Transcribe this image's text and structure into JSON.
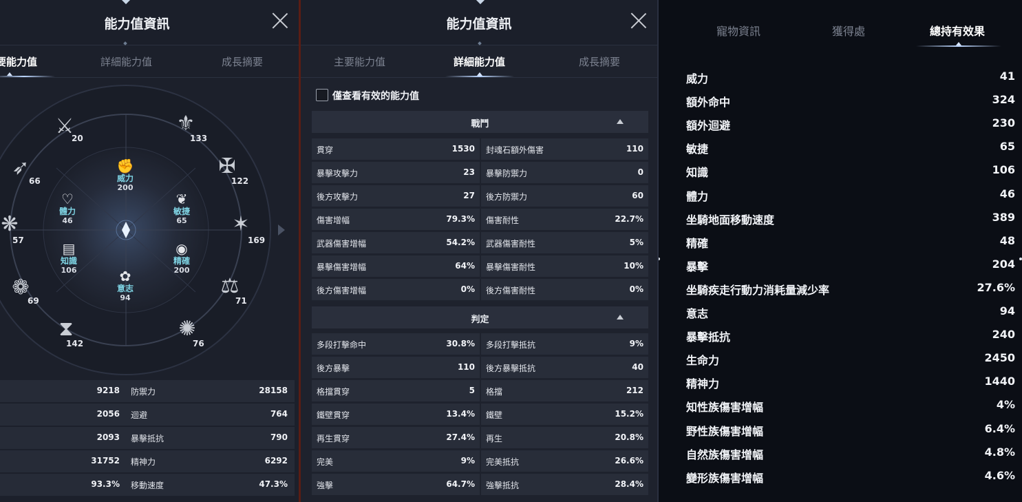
{
  "panel1": {
    "title": "能力值資訊",
    "tabs": [
      "要能力值",
      "詳細能力值",
      "成長摘要"
    ],
    "active_tab": 0,
    "center_stats": [
      {
        "label": "威力",
        "value": "200",
        "icon": "fist-icon"
      },
      {
        "label": "體力",
        "value": "46",
        "icon": "heart-icon"
      },
      {
        "label": "敏捷",
        "value": "65",
        "icon": "wing-icon"
      },
      {
        "label": "知識",
        "value": "106",
        "icon": "book-icon"
      },
      {
        "label": "精確",
        "value": "200",
        "icon": "eye-icon"
      },
      {
        "label": "意志",
        "value": "94",
        "icon": "lotus-icon"
      }
    ],
    "ring_values": [
      "20",
      "133",
      "66",
      "122",
      "57",
      "169",
      "69",
      "71",
      "142",
      "76"
    ],
    "stats": [
      {
        "left_value": "9218",
        "right_name": "防禦力",
        "right_value": "28158"
      },
      {
        "left_value": "2056",
        "right_name": "迴避",
        "right_value": "764"
      },
      {
        "left_value": "2093",
        "right_name": "暴擊抵抗",
        "right_value": "790"
      },
      {
        "left_value": "31752",
        "right_name": "精神力",
        "right_value": "6292"
      },
      {
        "left_value": "93.3%",
        "right_name": "移動速度",
        "right_value": "47.3%"
      }
    ]
  },
  "panel2": {
    "title": "能力值資訊",
    "tabs": [
      "主要能力值",
      "詳細能力值",
      "成長摘要"
    ],
    "active_tab": 1,
    "checkbox_label": "僅查看有效的能力值",
    "sections": [
      {
        "title": "戰鬥",
        "rows": [
          {
            "ln": "貫穿",
            "lv": "1530",
            "rn": "封魂石額外傷害",
            "rv": "110"
          },
          {
            "ln": "暴擊攻擊力",
            "lv": "23",
            "rn": "暴擊防禦力",
            "rv": "0"
          },
          {
            "ln": "後方攻擊力",
            "lv": "27",
            "rn": "後方防禦力",
            "rv": "60"
          },
          {
            "ln": "傷害增幅",
            "lv": "79.3%",
            "rn": "傷害耐性",
            "rv": "22.7%"
          },
          {
            "ln": "武器傷害增幅",
            "lv": "54.2%",
            "rn": "武器傷害耐性",
            "rv": "5%"
          },
          {
            "ln": "暴擊傷害增幅",
            "lv": "64%",
            "rn": "暴擊傷害耐性",
            "rv": "10%"
          },
          {
            "ln": "後方傷害增幅",
            "lv": "0%",
            "rn": "後方傷害耐性",
            "rv": "0%"
          }
        ]
      },
      {
        "title": "判定",
        "rows": [
          {
            "ln": "多段打擊命中",
            "lv": "30.8%",
            "rn": "多段打擊抵抗",
            "rv": "9%"
          },
          {
            "ln": "後方暴擊",
            "lv": "110",
            "rn": "後方暴擊抵抗",
            "rv": "40"
          },
          {
            "ln": "格擋貫穿",
            "lv": "5",
            "rn": "格擋",
            "rv": "212"
          },
          {
            "ln": "鐵壁貫穿",
            "lv": "13.4%",
            "rn": "鐵壁",
            "rv": "15.2%"
          },
          {
            "ln": "再生貫穿",
            "lv": "27.4%",
            "rn": "再生",
            "rv": "20.8%"
          },
          {
            "ln": "完美",
            "lv": "9%",
            "rn": "完美抵抗",
            "rv": "26.6%"
          },
          {
            "ln": "強擊",
            "lv": "64.7%",
            "rn": "強擊抵抗",
            "rv": "28.4%"
          }
        ]
      }
    ]
  },
  "panel3": {
    "tabs": [
      "寵物資訊",
      "獲得處",
      "總持有效果"
    ],
    "active_tab": 2,
    "effects": [
      {
        "name": "威力",
        "value": "41"
      },
      {
        "name": "額外命中",
        "value": "324"
      },
      {
        "name": "額外迴避",
        "value": "230"
      },
      {
        "name": "敏捷",
        "value": "65"
      },
      {
        "name": "知識",
        "value": "106"
      },
      {
        "name": "體力",
        "value": "46"
      },
      {
        "name": "坐騎地面移動速度",
        "value": "389"
      },
      {
        "name": "精確",
        "value": "48"
      },
      {
        "name": "暴擊",
        "value": "204"
      },
      {
        "name": "坐騎疾走行動力消耗量減少率",
        "value": "27.6%"
      },
      {
        "name": "意志",
        "value": "94"
      },
      {
        "name": "暴擊抵抗",
        "value": "240"
      },
      {
        "name": "生命力",
        "value": "2450"
      },
      {
        "name": "精神力",
        "value": "1440"
      },
      {
        "name": "知性族傷害增幅",
        "value": "4%"
      },
      {
        "name": "野性族傷害增幅",
        "value": "6.4%"
      },
      {
        "name": "自然族傷害增幅",
        "value": "4.8%"
      },
      {
        "name": "變形族傷害增幅",
        "value": "4.6%"
      }
    ]
  }
}
